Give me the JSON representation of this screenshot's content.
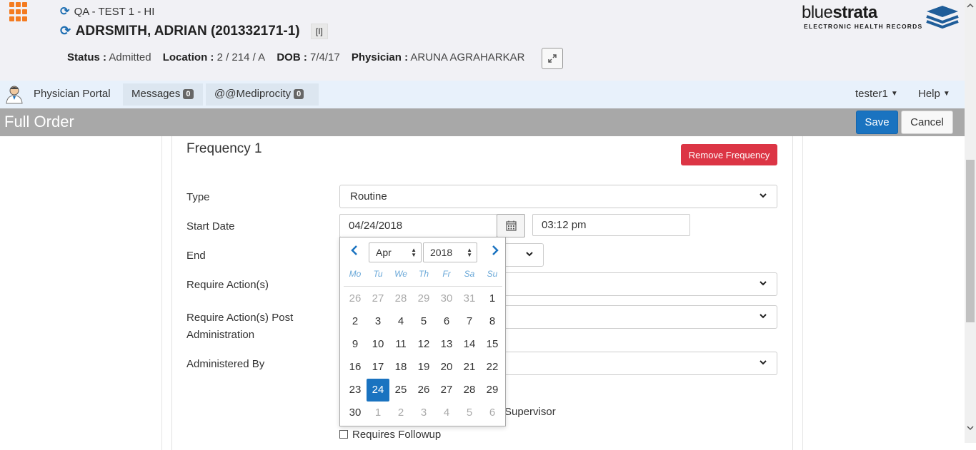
{
  "header": {
    "facility": "QA - TEST 1 - HI",
    "patient_name": "ADRSMITH, ADRIAN (201332171-1)",
    "flag": "[I]",
    "status_label": "Status :",
    "status_value": "Admitted",
    "location_label": "Location :",
    "location_value": "2 / 214 / A",
    "dob_label": "DOB :",
    "dob_value": "7/4/17",
    "physician_label": "Physician :",
    "physician_value": "ARUNA AGRAHARKAR"
  },
  "brand": {
    "name_light": "blue",
    "name_bold": "strata",
    "tagline": "ELECTRONIC HEALTH RECORDS"
  },
  "nav": {
    "physician_portal": "Physician Portal",
    "messages": "Messages",
    "messages_count": "0",
    "mediprocity": "@@Mediprocity",
    "mediprocity_count": "0",
    "user": "tester1",
    "help": "Help"
  },
  "titlebar": {
    "title": "Full Order",
    "save": "Save",
    "cancel": "Cancel"
  },
  "form": {
    "frequency_title": "Frequency 1",
    "remove_frequency": "Remove Frequency",
    "type_label": "Type",
    "type_value": "Routine",
    "start_date_label": "Start Date",
    "start_date_value": "04/24/2018",
    "start_time_value": "03:12 pm",
    "end_label": "End",
    "require_actions_label": "Require Action(s)",
    "require_actions_post_label_1": "Require Action(s) Post",
    "require_actions_post_label_2": "Administration",
    "administered_by_label": "Administered By",
    "supervisor_suffix": "Supervisor",
    "requires_followup_label": "Requires Followup"
  },
  "datepicker": {
    "month": "Apr",
    "year": "2018",
    "weekdays": [
      "Mo",
      "Tu",
      "We",
      "Th",
      "Fr",
      "Sa",
      "Su"
    ],
    "weeks": [
      [
        "26",
        "27",
        "28",
        "29",
        "30",
        "31",
        "1"
      ],
      [
        "2",
        "3",
        "4",
        "5",
        "6",
        "7",
        "8"
      ],
      [
        "9",
        "10",
        "11",
        "12",
        "13",
        "14",
        "15"
      ],
      [
        "16",
        "17",
        "18",
        "19",
        "20",
        "21",
        "22"
      ],
      [
        "23",
        "24",
        "25",
        "26",
        "27",
        "28",
        "29"
      ],
      [
        "30",
        "1",
        "2",
        "3",
        "4",
        "5",
        "6"
      ]
    ],
    "selected_day": "24",
    "accent_color": "#1a73c0"
  },
  "colors": {
    "primary": "#1a73c0",
    "danger": "#dc3545",
    "apps_icon": "#f47b20",
    "titlebar": "#a8a8a8"
  },
  "icons": {
    "apps": "apps-grid-icon",
    "refresh": "refresh-icon",
    "expand": "expand-icon",
    "calendar": "calendar-icon",
    "doctor": "doctor-avatar-icon"
  }
}
